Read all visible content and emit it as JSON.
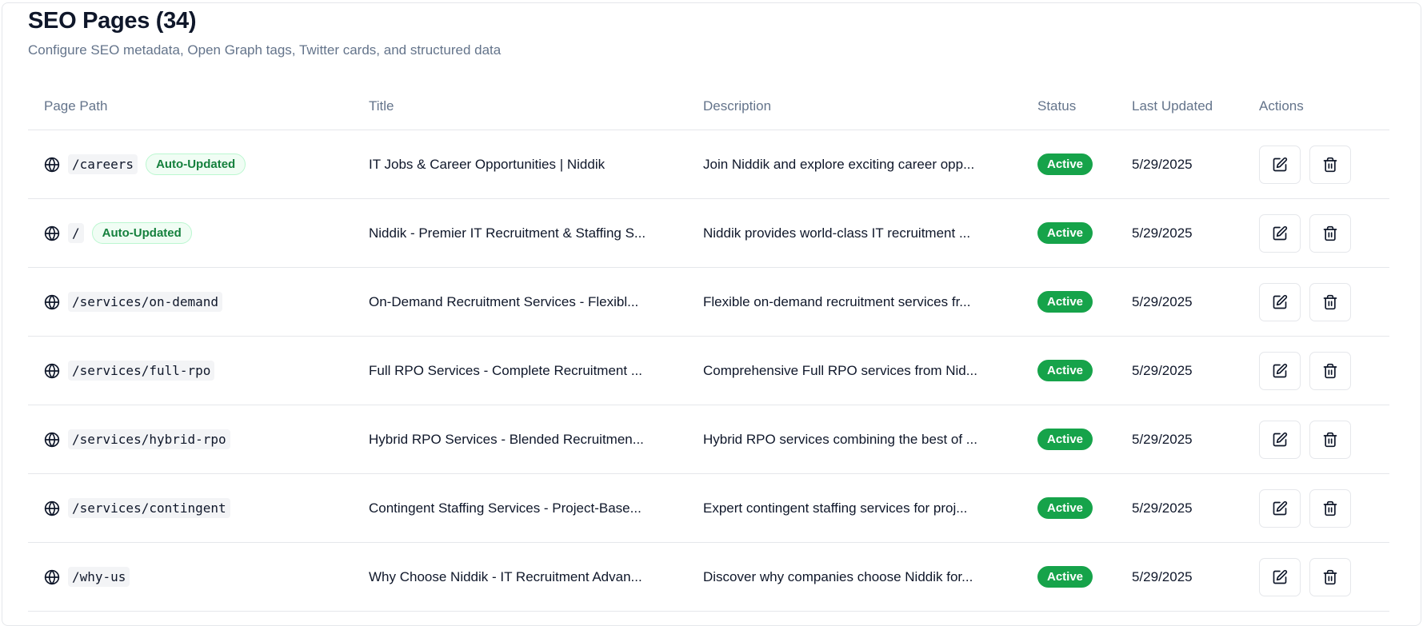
{
  "header": {
    "title": "SEO Pages (34)",
    "subtitle": "Configure SEO metadata, Open Graph tags, Twitter cards, and structured data"
  },
  "table": {
    "columns": [
      "Page Path",
      "Title",
      "Description",
      "Status",
      "Last Updated",
      "Actions"
    ],
    "rows": [
      {
        "path": "/careers",
        "badge": "Auto-Updated",
        "title": "IT Jobs & Career Opportunities | Niddik",
        "description": "Join Niddik and explore exciting career opp...",
        "status": "Active",
        "updated": "5/29/2025"
      },
      {
        "path": "/",
        "badge": "Auto-Updated",
        "title": "Niddik - Premier IT Recruitment & Staffing S...",
        "description": "Niddik provides world-class IT recruitment ...",
        "status": "Active",
        "updated": "5/29/2025"
      },
      {
        "path": "/services/on-demand",
        "badge": "",
        "title": "On-Demand Recruitment Services - Flexibl...",
        "description": "Flexible on-demand recruitment services fr...",
        "status": "Active",
        "updated": "5/29/2025"
      },
      {
        "path": "/services/full-rpo",
        "badge": "",
        "title": "Full RPO Services - Complete Recruitment ...",
        "description": "Comprehensive Full RPO services from Nid...",
        "status": "Active",
        "updated": "5/29/2025"
      },
      {
        "path": "/services/hybrid-rpo",
        "badge": "",
        "title": "Hybrid RPO Services - Blended Recruitmen...",
        "description": "Hybrid RPO services combining the best of ...",
        "status": "Active",
        "updated": "5/29/2025"
      },
      {
        "path": "/services/contingent",
        "badge": "",
        "title": "Contingent Staffing Services - Project-Base...",
        "description": "Expert contingent staffing services for proj...",
        "status": "Active",
        "updated": "5/29/2025"
      },
      {
        "path": "/why-us",
        "badge": "",
        "title": "Why Choose Niddik - IT Recruitment Advan...",
        "description": "Discover why companies choose Niddik for...",
        "status": "Active",
        "updated": "5/29/2025"
      }
    ]
  },
  "icons": {
    "row_icon": "globe-icon",
    "edit": "edit-icon",
    "delete": "trash-icon"
  },
  "colors": {
    "status_active": "#16a34a",
    "auto_badge_text": "#15803d",
    "muted_text": "#64748b"
  }
}
